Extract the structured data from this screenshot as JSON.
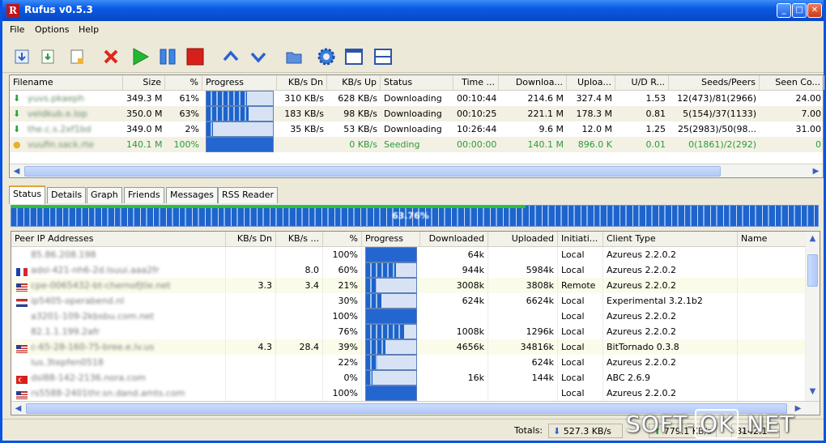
{
  "window": {
    "title": "Rufus v0.5.3",
    "app_icon_letter": "R"
  },
  "menu": [
    "File",
    "Options",
    "Help"
  ],
  "toolbar_icons": [
    "add-torrent-icon",
    "add-url-icon",
    "new-torrent-icon",
    "remove-icon",
    "start-icon",
    "pause-icon",
    "stop-icon",
    "move-up-icon",
    "move-down-icon",
    "open-folder-icon",
    "settings-icon",
    "view-window-icon",
    "view-split-icon"
  ],
  "torrents": {
    "columns": [
      "Filename",
      "Size",
      "%",
      "Progress",
      "KB/s Dn",
      "KB/s Up",
      "Status",
      "Time ...",
      "Downloa...",
      "Uploa...",
      "U/D R...",
      "Seeds/Peers",
      "Seen Co..."
    ],
    "rows": [
      {
        "icon": "down-arrow-icon",
        "name": "yuvs.pkaeph",
        "size": "349.3 M",
        "pct": "61%",
        "progress": 0.61,
        "dn": "310 KB/s",
        "up": "628 KB/s",
        "status": "Downloading",
        "time": "00:10:44",
        "downloaded": "214.6 M",
        "uploaded": "327.4 M",
        "ratio": "1.53",
        "seeds": "12(473)/81(2966)",
        "seen": "24.00",
        "seeding": false
      },
      {
        "icon": "down-arrow-icon",
        "name": "veldkub.e.lop",
        "size": "350.0 M",
        "pct": "63%",
        "progress": 0.63,
        "dn": "183 KB/s",
        "up": "98 KB/s",
        "status": "Downloading",
        "time": "00:10:25",
        "downloaded": "221.1 M",
        "uploaded": "178.3 M",
        "ratio": "0.81",
        "seeds": "5(154)/37(1133)",
        "seen": "7.00",
        "seeding": false
      },
      {
        "icon": "down-arrow-icon",
        "name": "the.c.s.2xf1bd",
        "size": "349.0 M",
        "pct": "2%",
        "progress": 0.02,
        "dn": "35 KB/s",
        "up": "53 KB/s",
        "status": "Downloading",
        "time": "10:26:44",
        "downloaded": "9.6 M",
        "uploaded": "12.0 M",
        "ratio": "1.25",
        "seeds": "25(2983)/50(98...",
        "seen": "31.00",
        "seeding": false
      },
      {
        "icon": "seed-icon",
        "name": "vuufin.sack.rte",
        "size": "140.1 M",
        "pct": "100%",
        "progress": 1.0,
        "dn": "",
        "up": "0 KB/s",
        "status": "Seeding",
        "time": "00:00:00",
        "downloaded": "140.1 M",
        "uploaded": "896.0 K",
        "ratio": "0.01",
        "seeds": "0(1861)/2(292)",
        "seen": "0",
        "seeding": true
      }
    ]
  },
  "tabs": [
    "Status",
    "Details",
    "Graph",
    "Friends",
    "Messages",
    "RSS Reader"
  ],
  "overall_progress": {
    "label": "63.76%",
    "value": 0.6376
  },
  "peers": {
    "columns": [
      "Peer IP Addresses",
      "KB/s Dn",
      "KB/s ...",
      "%",
      "Progress",
      "Downloaded",
      "Uploaded",
      "Initiati...",
      "Client Type",
      "Name"
    ],
    "rows": [
      {
        "flag": "none",
        "ip": "85.86.208.198",
        "dn": "",
        "up": "",
        "pct": "100%",
        "progress": 1.0,
        "downloaded": "64k",
        "uploaded": "",
        "init": "Local",
        "client": "Azureus 2.2.0.2"
      },
      {
        "flag": "fr",
        "ip": "adsl-421-nh6-2d.lsuui.aaa2fr",
        "dn": "",
        "up": "8.0",
        "pct": "60%",
        "progress": 0.6,
        "downloaded": "944k",
        "uploaded": "5984k",
        "init": "Local",
        "client": "Azureus 2.2.0.2"
      },
      {
        "flag": "us",
        "ip": "cpe-0065432-bt-chernofjtle.net",
        "dn": "3.3",
        "up": "3.4",
        "pct": "21%",
        "progress": 0.21,
        "downloaded": "3008k",
        "uploaded": "3808k",
        "init": "Remote",
        "client": "Azureus 2.2.0.2"
      },
      {
        "flag": "nl",
        "ip": "ip5405-operabend.nl",
        "dn": "",
        "up": "",
        "pct": "30%",
        "progress": 0.3,
        "downloaded": "624k",
        "uploaded": "6624k",
        "init": "Local",
        "client": "Experimental 3.2.1b2"
      },
      {
        "flag": "none",
        "ip": "a3201-109-2kbsbu.com.net",
        "dn": "",
        "up": "",
        "pct": "100%",
        "progress": 1.0,
        "downloaded": "",
        "uploaded": "",
        "init": "Local",
        "client": "Azureus 2.2.0.2"
      },
      {
        "flag": "none",
        "ip": "82.1.1.199.2afr",
        "dn": "",
        "up": "",
        "pct": "76%",
        "progress": 0.76,
        "downloaded": "1008k",
        "uploaded": "1296k",
        "init": "Local",
        "client": "Azureus 2.2.0.2"
      },
      {
        "flag": "us",
        "ip": "c-65-28-160-75-bree.e.lv.us",
        "dn": "4.3",
        "up": "28.4",
        "pct": "39%",
        "progress": 0.39,
        "downloaded": "4656k",
        "uploaded": "34816k",
        "init": "Local",
        "client": "BitTornado 0.3.8"
      },
      {
        "flag": "none",
        "ip": "lus.3tepfen0518",
        "dn": "",
        "up": "",
        "pct": "22%",
        "progress": 0.22,
        "downloaded": "",
        "uploaded": "624k",
        "init": "Local",
        "client": "Azureus 2.2.0.2"
      },
      {
        "flag": "tr",
        "ip": "dsl88-142-2136.nora.com",
        "dn": "",
        "up": "",
        "pct": "0%",
        "progress": 0.0,
        "downloaded": "16k",
        "uploaded": "144k",
        "init": "Local",
        "client": "ABC 2.6.9"
      },
      {
        "flag": "us",
        "ip": "rs5588-2401thr.sn.dand.amts.com",
        "dn": "",
        "up": "",
        "pct": "100%",
        "progress": 1.0,
        "downloaded": "",
        "uploaded": "",
        "init": "Local",
        "client": "Azureus 2.2.0.2"
      }
    ]
  },
  "statusbar": {
    "totals_label": "Totals:",
    "dn_total": "527.3 KB/s",
    "up_total": "779.1 KB/s",
    "extra": "8142.1"
  },
  "watermark": {
    "prefix": "SOFT-",
    "ok": "OK",
    "suffix": ".NET"
  }
}
